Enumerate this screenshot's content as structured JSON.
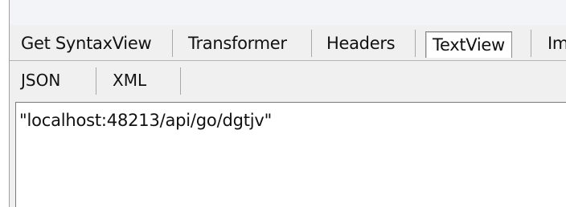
{
  "tabs": {
    "items": [
      "Get SyntaxView",
      "Transformer",
      "Headers",
      "TextView",
      "Im"
    ],
    "active_index": 3
  },
  "subtabs": {
    "items": [
      "JSON",
      "XML"
    ]
  },
  "response": {
    "text": "\"localhost:48213/api/go/dgtjv\""
  },
  "colors": {
    "background": "#f0f0f0",
    "panel": "#ffffff",
    "border": "#7a7a7a",
    "text": "#111111"
  }
}
